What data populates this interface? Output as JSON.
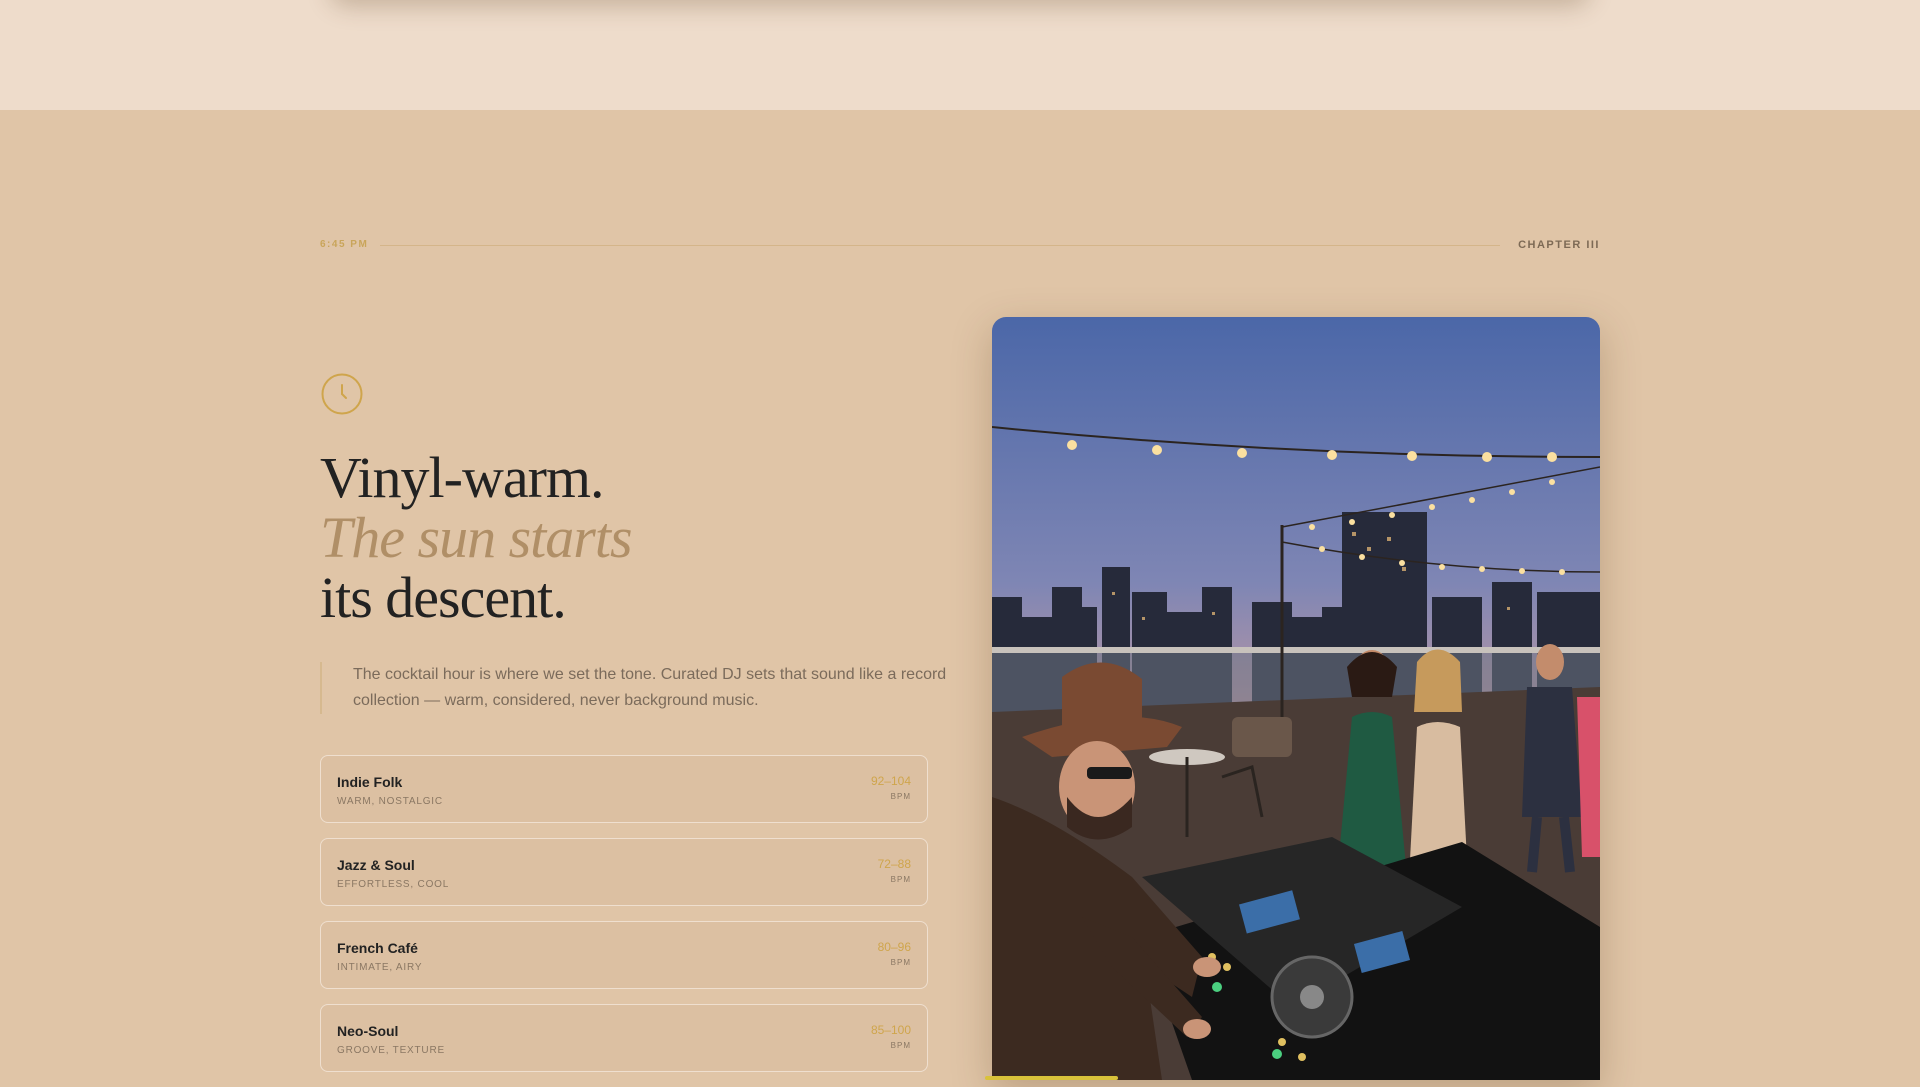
{
  "header": {
    "time": "6:45 PM",
    "chapter": "CHAPTER III"
  },
  "hero": {
    "headline_line1": "Vinyl-warm.",
    "headline_line2": "The sun starts",
    "headline_line3": "its descent.",
    "intro": "The cocktail hour is where we set the tone. Curated DJ sets that sound like a record collection — warm, considered, never background music.",
    "icon": "clock-icon"
  },
  "genres": [
    {
      "name": "Indie Folk",
      "desc": "WARM, NOSTALGIC",
      "bpm": "92–104",
      "unit": "BPM"
    },
    {
      "name": "Jazz & Soul",
      "desc": "EFFORTLESS, COOL",
      "bpm": "72–88",
      "unit": "BPM"
    },
    {
      "name": "French Café",
      "desc": "INTIMATE, AIRY",
      "bpm": "80–96",
      "unit": "BPM"
    },
    {
      "name": "Neo-Soul",
      "desc": "GROOVE, TEXTURE",
      "bpm": "85–100",
      "unit": "BPM"
    }
  ],
  "colors": {
    "background": "#e0c5a7",
    "accent_gold": "#cfa54c",
    "italic_tan": "#b08f67",
    "ink": "#222222"
  }
}
